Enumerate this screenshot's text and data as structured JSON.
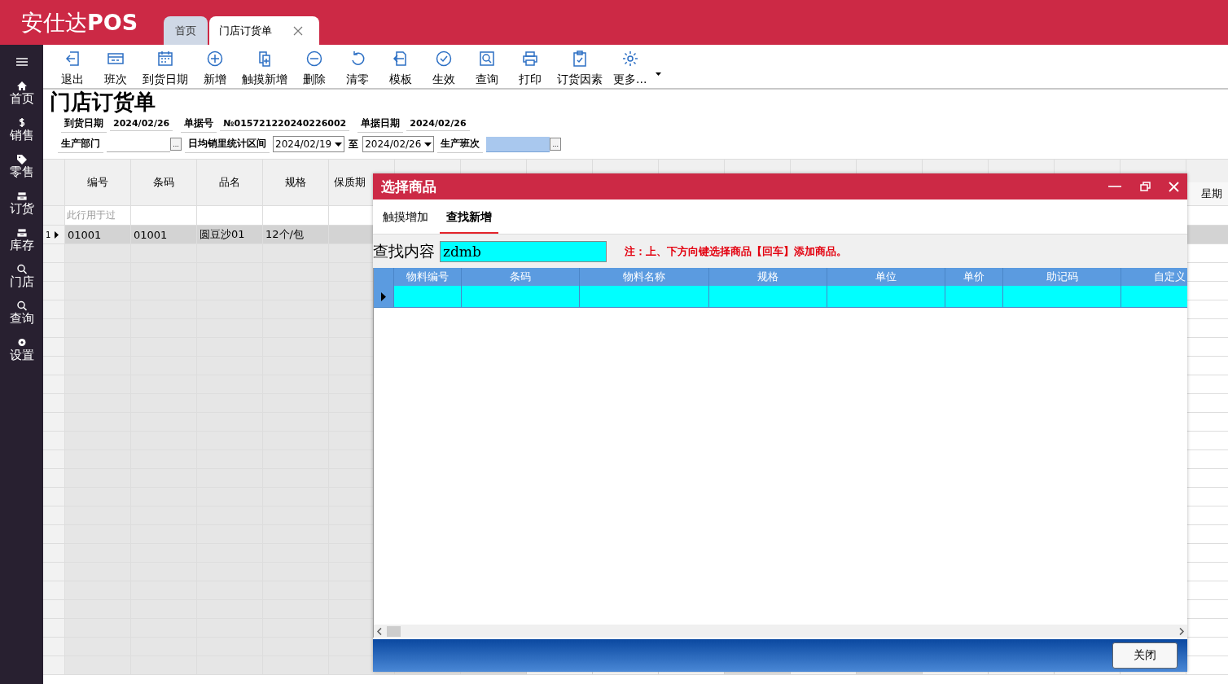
{
  "app": {
    "logo": "安仕达**POS**"
  },
  "tabs": [
    {
      "label": "首页",
      "selected": false,
      "closable": false
    },
    {
      "label": "门店订货单",
      "selected": true,
      "closable": true
    }
  ],
  "sidebar": {
    "items": [
      "首页",
      "销售",
      "零售",
      "订货",
      "库存",
      "门店",
      "查询",
      "设置"
    ]
  },
  "toolbar": {
    "buttons": [
      "退出",
      "班次",
      "到货日期",
      "新增",
      "触摸新增",
      "删除",
      "清零",
      "模板",
      "生效",
      "查询",
      "打印",
      "订货因素",
      "更多..."
    ]
  },
  "form": {
    "title": "门店订货单",
    "info": [
      {
        "label": "到货日期",
        "value": "2024/02/26"
      },
      {
        "label": "单据号",
        "value": "№015721220240226002"
      },
      {
        "label": "单据日期",
        "value": "2024/02/26"
      }
    ],
    "filters": [
      {
        "kind": "lookup",
        "label": "生产部门",
        "button": "...",
        "focused": false
      },
      {
        "kind": "range",
        "label": "日均销里统计区间",
        "from": "2024/02/19",
        "to_label": "至",
        "to": "2024/02/26"
      },
      {
        "kind": "lookup",
        "label": "生产班次",
        "button": "...",
        "focused": true
      }
    ]
  },
  "grid": {
    "columns": [
      "编号",
      "条码",
      "品名",
      "规格",
      "保质期"
    ],
    "subheaders": [
      "星期"
    ],
    "filter_hint": "此行用于过",
    "rows": [
      {
        "number": "1",
        "selected": true,
        "cells": [
          "01001",
          "01001",
          "圆豆沙01",
          "12个/包"
        ]
      }
    ]
  },
  "dialog": {
    "title": "选择商品",
    "tabs": [
      {
        "label": "触摸增加",
        "selected": false
      },
      {
        "label": "查找新增",
        "selected": true
      }
    ],
    "search": {
      "label": "查找内容",
      "value": "zdmb"
    },
    "note": "注：上、下方向键选择商品【回车】添加商品。",
    "table": {
      "columns": [
        "物料编号",
        "条码",
        "物料名称",
        "规格",
        "单位",
        "单价",
        "助记码",
        "自定义"
      ],
      "rows": [
        {
          "selected": true
        }
      ]
    },
    "buttons": [
      "关闭"
    ]
  }
}
